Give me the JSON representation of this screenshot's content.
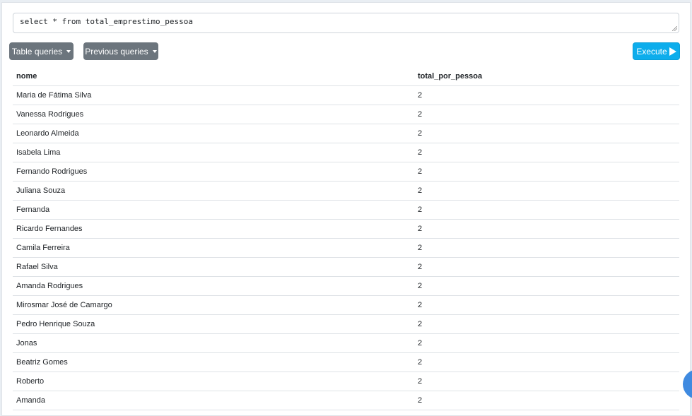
{
  "query": {
    "text": "select * from total_emprestimo_pessoa"
  },
  "toolbar": {
    "table_queries_label": "Table queries",
    "previous_queries_label": "Previous queries",
    "execute_label": "Execute"
  },
  "results": {
    "columns": [
      "nome",
      "total_por_pessoa"
    ],
    "rows": [
      [
        "Maria de Fátima Silva",
        "2"
      ],
      [
        "Vanessa Rodrigues",
        "2"
      ],
      [
        "Leonardo Almeida",
        "2"
      ],
      [
        "Isabela Lima",
        "2"
      ],
      [
        "Fernando Rodrigues",
        "2"
      ],
      [
        "Juliana Souza",
        "2"
      ],
      [
        "Fernanda",
        "2"
      ],
      [
        "Ricardo Fernandes",
        "2"
      ],
      [
        "Camila Ferreira",
        "2"
      ],
      [
        "Rafael Silva",
        "2"
      ],
      [
        "Amanda Rodrigues",
        "2"
      ],
      [
        "Mirosmar José de Camargo",
        "2"
      ],
      [
        "Pedro Henrique Souza",
        "2"
      ],
      [
        "Jonas",
        "2"
      ],
      [
        "Beatriz Gomes",
        "2"
      ],
      [
        "Roberto",
        "2"
      ],
      [
        "Amanda",
        "2"
      ]
    ]
  },
  "icons": {
    "dropdown": "caret-down-icon",
    "execute": "play-icon",
    "resize": "resize-grip-icon"
  },
  "colors": {
    "secondary_button": "#6c757d",
    "execute_button": "#0dadec",
    "fab": "#3f8ae0"
  }
}
